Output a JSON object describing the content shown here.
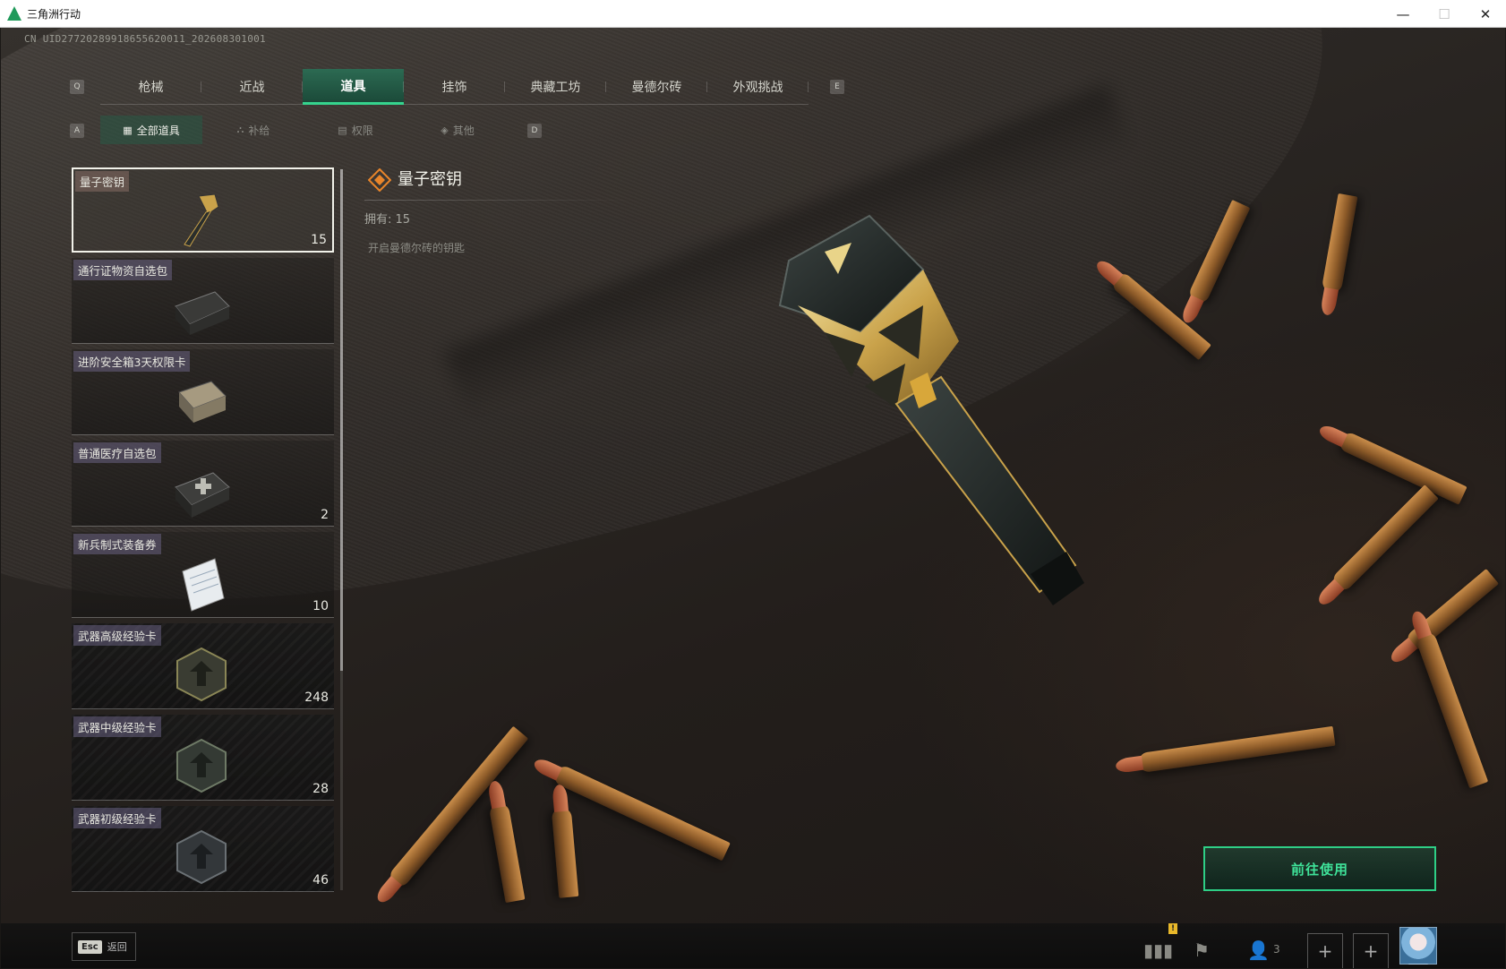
{
  "window": {
    "title": "三角洲行动",
    "controls": [
      "—",
      "☐",
      "✕"
    ]
  },
  "header": {
    "uid": "CN UID27720289918655620011_202608301001"
  },
  "tabs": [
    {
      "label": "枪械"
    },
    {
      "label": "近战"
    },
    {
      "label": "道具",
      "active": true
    },
    {
      "label": "挂饰"
    },
    {
      "label": "典藏工坊"
    },
    {
      "label": "曼德尔砖"
    },
    {
      "label": "外观挑战"
    }
  ],
  "tab_keys": {
    "prev": "Q",
    "next": "E"
  },
  "subtabs": [
    {
      "label": "全部道具",
      "icon": "grid-icon",
      "glyph": "▦",
      "active": true
    },
    {
      "label": "补给",
      "icon": "supply-icon",
      "glyph": "⛬"
    },
    {
      "label": "权限",
      "icon": "permission-icon",
      "glyph": "▤"
    },
    {
      "label": "其他",
      "icon": "other-icon",
      "glyph": "◈"
    }
  ],
  "subtab_keys": {
    "prev": "A",
    "next": "D"
  },
  "items": [
    {
      "name": "量子密钥",
      "count": "15",
      "selected": true,
      "thumb": "key"
    },
    {
      "name": "通行证物资自选包",
      "count": "",
      "thumb": "case"
    },
    {
      "name": "进阶安全箱3天权限卡",
      "count": "",
      "thumb": "box"
    },
    {
      "name": "普通医疗自选包",
      "count": "2",
      "thumb": "medcase"
    },
    {
      "name": "新兵制式装备券",
      "count": "10",
      "thumb": "paper"
    },
    {
      "name": "武器高级经验卡",
      "count": "248",
      "thumb": "badge-gold"
    },
    {
      "name": "武器中级经验卡",
      "count": "28",
      "thumb": "badge-green"
    },
    {
      "name": "武器初级经验卡",
      "count": "46",
      "thumb": "badge-gray"
    }
  ],
  "detail": {
    "name": "量子密钥",
    "owned": "拥有: 15",
    "description": "开启曼德尔砖的钥匙"
  },
  "action": {
    "label": "前往使用"
  },
  "bottom": {
    "esc_key": "Esc",
    "esc_label": "返回",
    "friends_count": "3",
    "notification": "!"
  },
  "colors": {
    "accent": "#35d48e",
    "tab_active": "#2c6a52",
    "button_text": "#3fe39a"
  }
}
